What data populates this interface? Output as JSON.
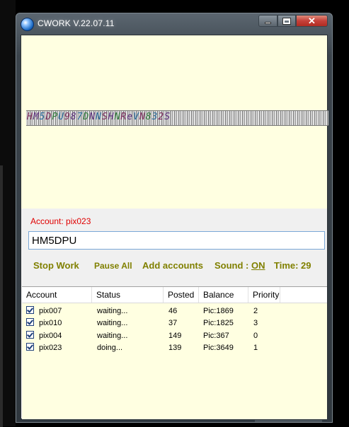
{
  "window": {
    "title": "CWORK V.22.07.11",
    "icon": "globe-icon",
    "controls": {
      "minimize": "minimize-icon",
      "maximize": "maximize-icon",
      "close": "✕"
    }
  },
  "captcha": {
    "text": "HM5DPU987DNNSHNReVN832S"
  },
  "account": {
    "label": "Account: pix023"
  },
  "answer": {
    "value": "HM5DPU"
  },
  "toolbar": {
    "stop_label": "Stop Work",
    "pause_label": "Pause All",
    "add_label": "Add accounts",
    "sound_label": "Sound :",
    "sound_state": "ON",
    "time_label": "Time: 29"
  },
  "accounts_table": {
    "columns": [
      "Account",
      "Status",
      "Posted",
      "Balance",
      "Priority"
    ],
    "rows": [
      {
        "checked": true,
        "account": "pix007",
        "status": "waiting...",
        "posted": "46",
        "balance": "Pic:1869",
        "priority": "2"
      },
      {
        "checked": true,
        "account": "pix010",
        "status": "waiting...",
        "posted": "37",
        "balance": "Pic:1825",
        "priority": "3"
      },
      {
        "checked": true,
        "account": "pix004",
        "status": "waiting...",
        "posted": "149",
        "balance": "Pic:367",
        "priority": "0"
      },
      {
        "checked": true,
        "account": "pix023",
        "status": "doing...",
        "posted": "139",
        "balance": "Pic:3649",
        "priority": "1"
      }
    ]
  },
  "colors": {
    "panel_bg": "#ffffe1",
    "account_label": "#e00000",
    "toolbar_text": "#808000",
    "close_button": "#c5413a"
  }
}
